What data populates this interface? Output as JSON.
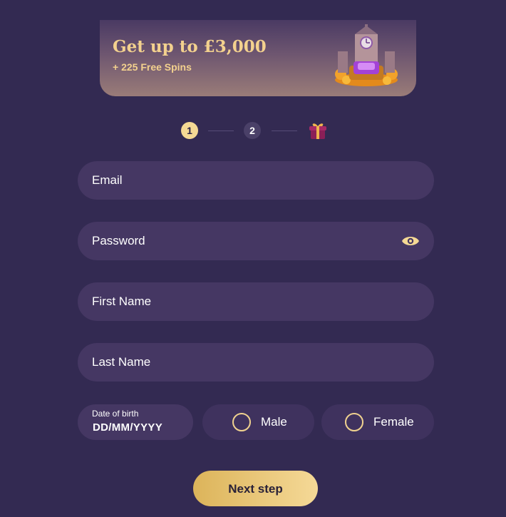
{
  "banner": {
    "title": "Get up to £3,000",
    "subtitle": "+ 225 Free Spins"
  },
  "stepper": {
    "step1": "1",
    "step2": "2",
    "final_icon": "gift-icon"
  },
  "form": {
    "email_label": "Email",
    "password_label": "Password",
    "first_name_label": "First Name",
    "last_name_label": "Last Name",
    "dob_label": "Date of birth",
    "dob_value": "DD/MM/YYYY",
    "male_label": "Male",
    "female_label": "Female",
    "next_label": "Next step",
    "password_toggle_icon": "eye-icon"
  },
  "colors": {
    "background": "#332a52",
    "field": "#453763",
    "accent_gold": "#f5d994"
  }
}
